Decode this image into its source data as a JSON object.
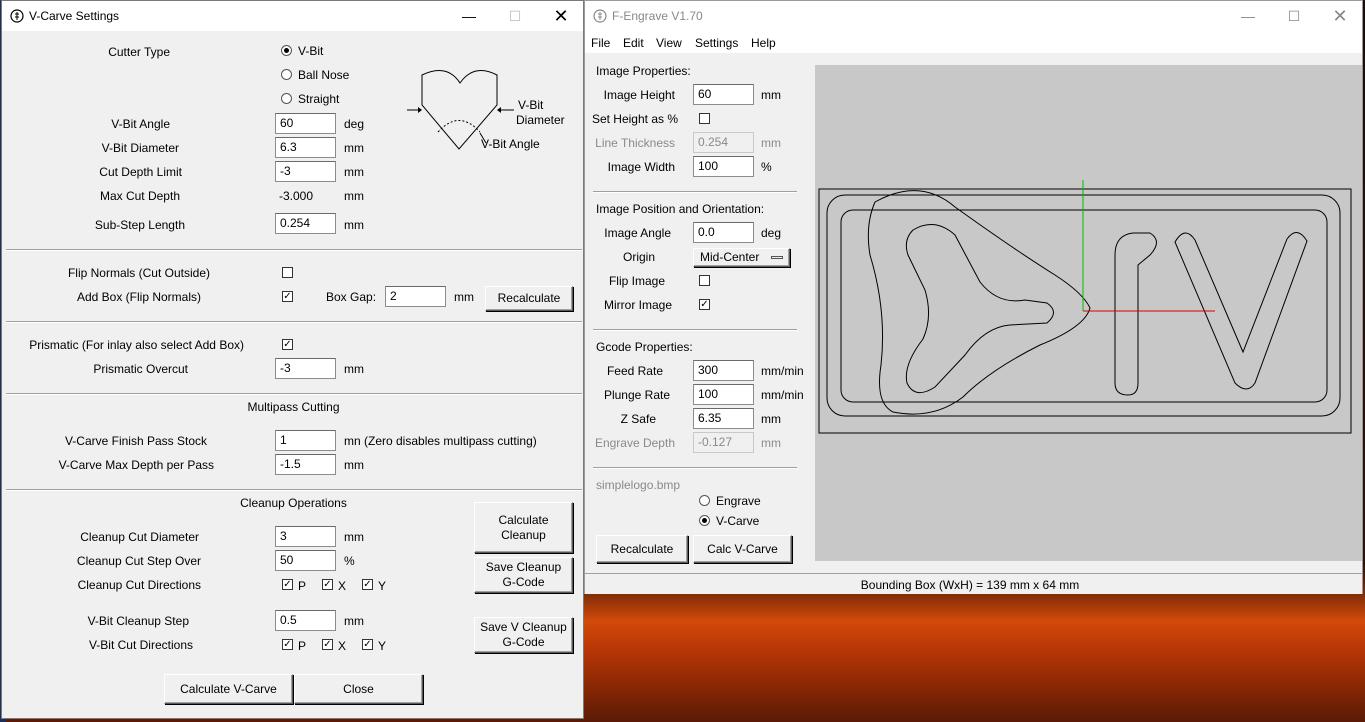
{
  "desktop": {},
  "vcarve": {
    "title": "V-Carve Settings",
    "cutter_type_label": "Cutter Type",
    "cutter_options": [
      "V-Bit",
      "Ball Nose",
      "Straight"
    ],
    "cutter_selected": "V-Bit",
    "diagram": {
      "vbit_diameter": "V-Bit\nDiameter",
      "vbit_angle": "V-Bit Angle",
      "vbit_label": "V-Bit",
      "diameter_label": "Diameter"
    },
    "vbit_angle": {
      "label": "V-Bit Angle",
      "value": "60",
      "unit": "deg"
    },
    "vbit_diameter": {
      "label": "V-Bit Diameter",
      "value": "6.3",
      "unit": "mm"
    },
    "cut_depth_limit": {
      "label": "Cut Depth Limit",
      "value": "-3",
      "unit": "mm"
    },
    "max_cut_depth": {
      "label": "Max Cut Depth",
      "value": "-3.000",
      "unit": "mm"
    },
    "sub_step": {
      "label": "Sub-Step Length",
      "value": "0.254",
      "unit": "mm"
    },
    "flip_normals": {
      "label": "Flip Normals (Cut Outside)",
      "checked": false
    },
    "add_box": {
      "label": "Add Box (Flip Normals)",
      "checked": true
    },
    "box_gap": {
      "label": "Box Gap:",
      "value": "2",
      "unit": "mm"
    },
    "recalculate": "Recalculate",
    "prismatic": {
      "label": "Prismatic (For inlay also select Add Box)",
      "checked": true
    },
    "prismatic_overcut": {
      "label": "Prismatic Overcut",
      "value": "-3",
      "unit": "mm"
    },
    "multipass_heading": "Multipass Cutting",
    "finish_stock": {
      "label": "V-Carve Finish Pass Stock",
      "value": "1",
      "unit": "mn (Zero disables multipass cutting)"
    },
    "max_depth_pass": {
      "label": "V-Carve Max Depth per Pass",
      "value": "-1.5",
      "unit": "mm"
    },
    "cleanup_heading": "Cleanup Operations",
    "cleanup_diameter": {
      "label": "Cleanup Cut Diameter",
      "value": "3",
      "unit": "mm"
    },
    "cleanup_stepover": {
      "label": "Cleanup Cut Step Over",
      "value": "50",
      "unit": "%"
    },
    "cleanup_directions": {
      "label": "Cleanup Cut Directions",
      "p": "P",
      "x": "X",
      "y": "Y"
    },
    "vbit_cleanup_step": {
      "label": "V-Bit Cleanup Step",
      "value": "0.5",
      "unit": "mm"
    },
    "vbit_directions": {
      "label": "V-Bit Cut Directions",
      "p": "P",
      "x": "X",
      "y": "Y"
    },
    "calc_cleanup": "Calculate Cleanup",
    "save_cleanup": "Save Cleanup G-Code",
    "save_v_cleanup": "Save V Cleanup G-Code",
    "calc_vcarve": "Calculate V-Carve",
    "close": "Close"
  },
  "fengrave": {
    "title": "F-Engrave V1.70",
    "menu": [
      "File",
      "Edit",
      "View",
      "Settings",
      "Help"
    ],
    "image_props_heading": "Image Properties:",
    "image_height": {
      "label": "Image Height",
      "value": "60",
      "unit": "mm"
    },
    "set_height_pct": {
      "label": "Set Height as %",
      "checked": false
    },
    "line_thickness": {
      "label": "Line Thickness",
      "value": "0.254",
      "unit": "mm"
    },
    "image_width": {
      "label": "Image Width",
      "value": "100",
      "unit": "%"
    },
    "position_heading": "Image Position and Orientation:",
    "image_angle": {
      "label": "Image Angle",
      "value": "0.0",
      "unit": "deg"
    },
    "origin": {
      "label": "Origin",
      "value": "Mid-Center"
    },
    "flip_image": {
      "label": "Flip Image",
      "checked": false
    },
    "mirror_image": {
      "label": "Mirror Image",
      "checked": true
    },
    "gcode_heading": "Gcode Properties:",
    "feed_rate": {
      "label": "Feed Rate",
      "value": "300",
      "unit": "mm/min"
    },
    "plunge_rate": {
      "label": "Plunge Rate",
      "value": "100",
      "unit": "mm/min"
    },
    "z_safe": {
      "label": "Z Safe",
      "value": "6.35",
      "unit": "mm"
    },
    "engrave_depth": {
      "label": "Engrave Depth",
      "value": "-0.127",
      "unit": "mm"
    },
    "filename": "simplelogo.bmp",
    "mode_options": [
      "Engrave",
      "V-Carve"
    ],
    "mode_selected": "V-Carve",
    "recalculate": "Recalculate",
    "calc_vcarve": "Calc V-Carve",
    "status": "Bounding Box (WxH) = 139 mm  x 64 mm",
    "colors": {
      "canvas_bg": "#c8c8c8",
      "x_axis": "#e00000",
      "y_axis": "#00c000"
    }
  }
}
